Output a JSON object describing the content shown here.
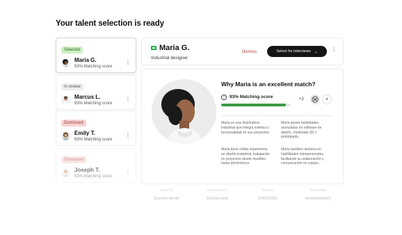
{
  "page": {
    "title": "Your talent selection is ready"
  },
  "candidates": [
    {
      "status": "Selected",
      "status_color": "#cfeec5",
      "name": "Maria G.",
      "score": "93% Matching score"
    },
    {
      "status": "In review",
      "status_color": "#eeeeee",
      "name": "Marcus L.",
      "score": "93% Matching score"
    },
    {
      "status": "Dismissed",
      "status_color": "#f6d3d3",
      "name": "Emily T.",
      "score": "93% Matching score"
    },
    {
      "status": "Dismissed",
      "status_color": "#f6d3d3",
      "name": "Joseph T.",
      "score": "93% Matching score"
    }
  ],
  "header": {
    "name": "Maria G.",
    "role": "Industrial designer",
    "dismiss_label": "Dismiss",
    "select_label": "Select for interviews",
    "icons": {
      "flag": "flag-icon",
      "chevron": "chevron-down-icon",
      "menu": "kebab-icon"
    }
  },
  "detail": {
    "title": "Why Maria is an excellent match?",
    "match_label": "93% Matching score",
    "match_fraction": 0.93,
    "match_color": "#3a9a46",
    "extra_count": "+2",
    "logos": [
      "VW",
      "✳"
    ],
    "paragraphs": {
      "left_1": "Maria es una diseñadora industrial que integra estética y funcionalidad en sus proyectos.",
      "left_2": "Maria tiene sólida experiencia en diseño industrial, trabajando en proyectos desde muebles hasta electrónicos.",
      "right_1": "Maria posee habilidades avanzadas en software de diseño, modelado 3D y prototipado.",
      "right_2": "María también destaca en habilidades interpersonales, facilitando la colaboración y comunicación en equipo."
    }
  },
  "stats": [
    {
      "label": "Seniority",
      "value": "Senior level"
    },
    {
      "label": "English level",
      "value": "Advanced"
    },
    {
      "label": "Budget",
      "value": "1000USD"
    },
    {
      "label": "Availability",
      "value": "Immediately"
    }
  ],
  "colors": {
    "dismiss": "#b83a3a",
    "primary_button": "#161616"
  }
}
